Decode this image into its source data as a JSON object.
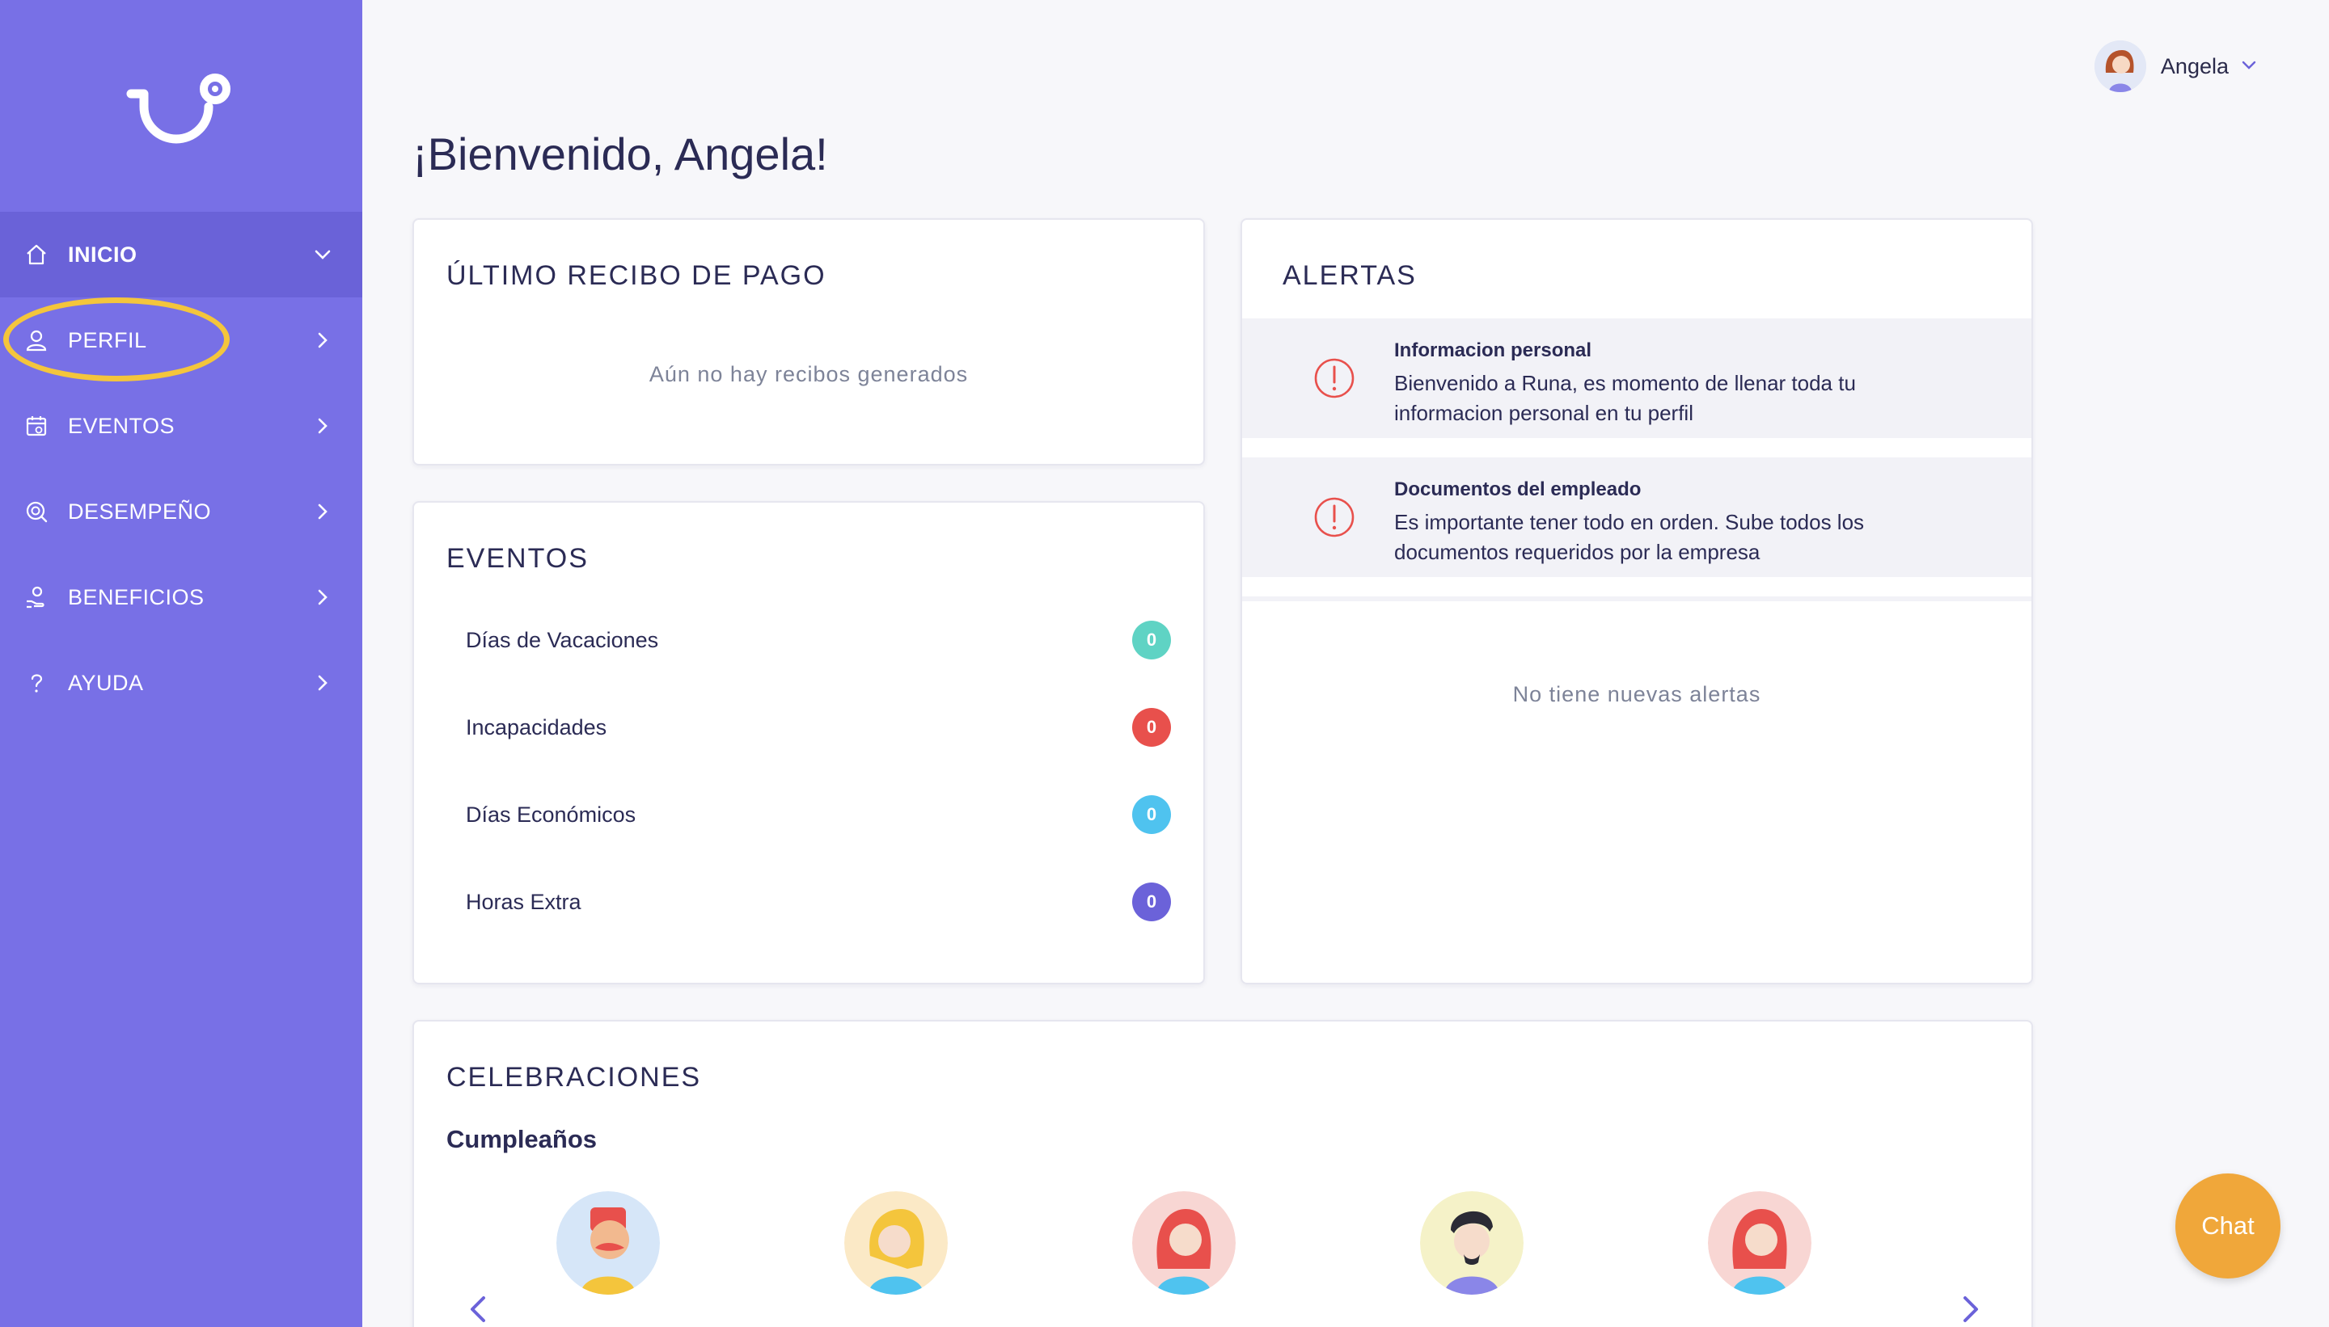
{
  "sidebar": {
    "items": [
      {
        "label": "INICIO",
        "icon": "home-icon"
      },
      {
        "label": "PERFIL",
        "icon": "user-icon"
      },
      {
        "label": "EVENTOS",
        "icon": "calendar-icon"
      },
      {
        "label": "DESEMPEÑO",
        "icon": "performance-icon"
      },
      {
        "label": "BENEFICIOS",
        "icon": "benefits-icon"
      },
      {
        "label": "AYUDA",
        "icon": "help-icon"
      }
    ]
  },
  "header": {
    "user_name": "Angela",
    "welcome": "¡Bienvenido, Angela!"
  },
  "payslip": {
    "title": "ÚLTIMO RECIBO DE PAGO",
    "empty": "Aún no hay recibos generados"
  },
  "events": {
    "title": "EVENTOS",
    "rows": [
      {
        "label": "Días de Vacaciones",
        "count": "0",
        "color": "#5fd3c4"
      },
      {
        "label": "Incapacidades",
        "count": "0",
        "color": "#e8504c"
      },
      {
        "label": "Días Económicos",
        "count": "0",
        "color": "#4fc3ef"
      },
      {
        "label": "Horas Extra",
        "count": "0",
        "color": "#6b62d9"
      }
    ]
  },
  "alerts": {
    "title": "ALERTAS",
    "items": [
      {
        "title": "Informacion personal",
        "text": "Bienvenido a Runa, es momento de llenar toda tu informacion personal en tu perfil"
      },
      {
        "title": "Documentos del empleado",
        "text": "Es importante tener todo en orden. Sube todos los documentos requeridos por la empresa"
      }
    ],
    "empty": "No tiene nuevas alertas"
  },
  "celebrations": {
    "title": "CELEBRACIONES",
    "subtitle": "Cumpleaños"
  },
  "chat": {
    "label": "Chat"
  },
  "colors": {
    "sidebar": "#7870e6",
    "sidebar_active": "#6a62d8",
    "highlight": "#f4c53c",
    "alert_red": "#e8504c",
    "chat": "#f0a73a"
  }
}
